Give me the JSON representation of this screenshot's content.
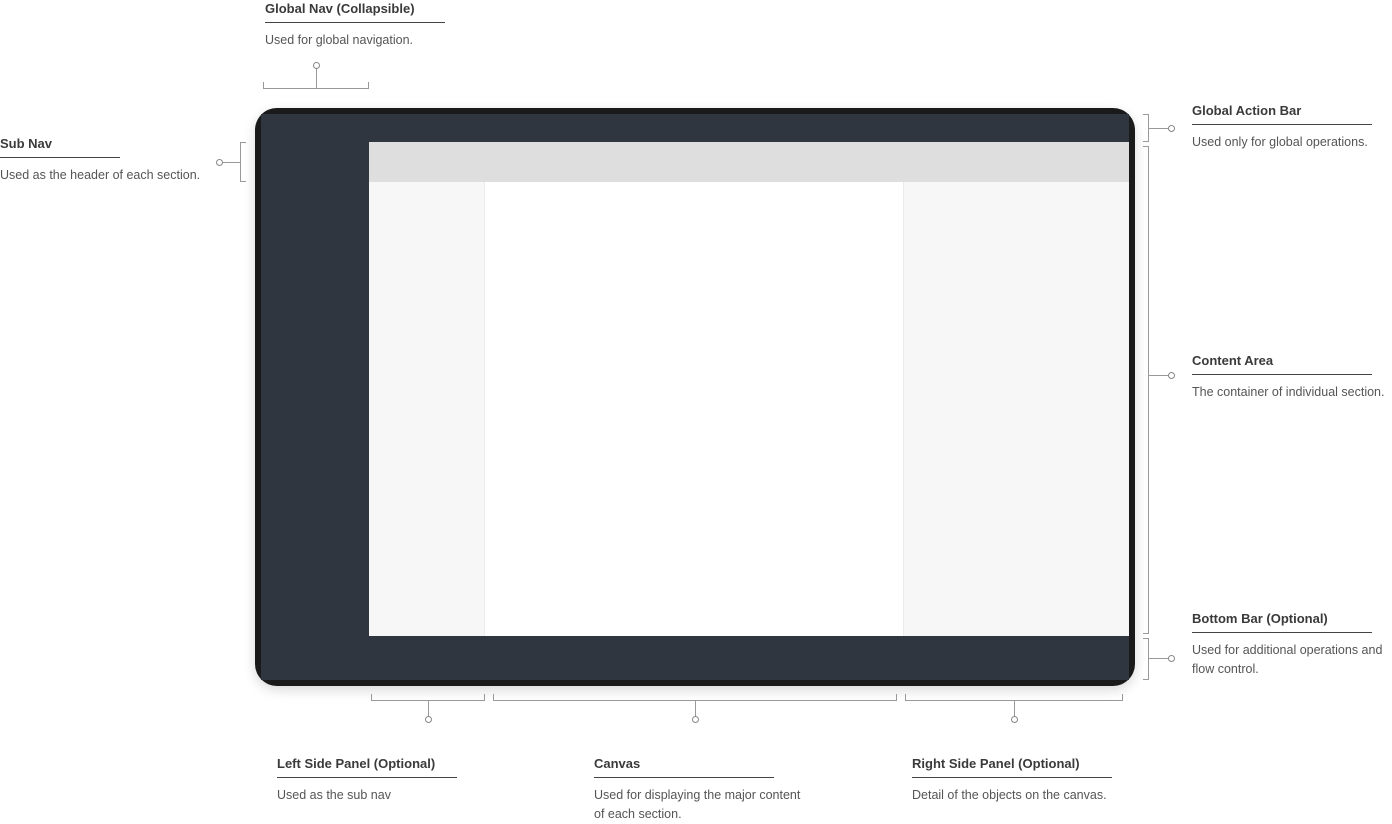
{
  "annotations": {
    "global_nav": {
      "title": "Global Nav (Collapsible)",
      "desc": "Used for global navigation."
    },
    "sub_nav": {
      "title": "Sub Nav",
      "desc": "Used as the header of each section."
    },
    "global_action_bar": {
      "title": "Global Action Bar",
      "desc": "Used only for global operations."
    },
    "content_area": {
      "title": "Content Area",
      "desc": "The container of individual section."
    },
    "bottom_bar": {
      "title": "Bottom Bar (Optional)",
      "desc": "Used for additional operations and flow control."
    },
    "left_side_panel": {
      "title": "Left Side Panel (Optional)",
      "desc": "Used as the sub nav"
    },
    "canvas": {
      "title": "Canvas",
      "desc": "Used for displaying the major content of each section."
    },
    "right_side_panel": {
      "title": "Right Side Panel  (Optional)",
      "desc": "Detail of the objects on the canvas."
    }
  }
}
